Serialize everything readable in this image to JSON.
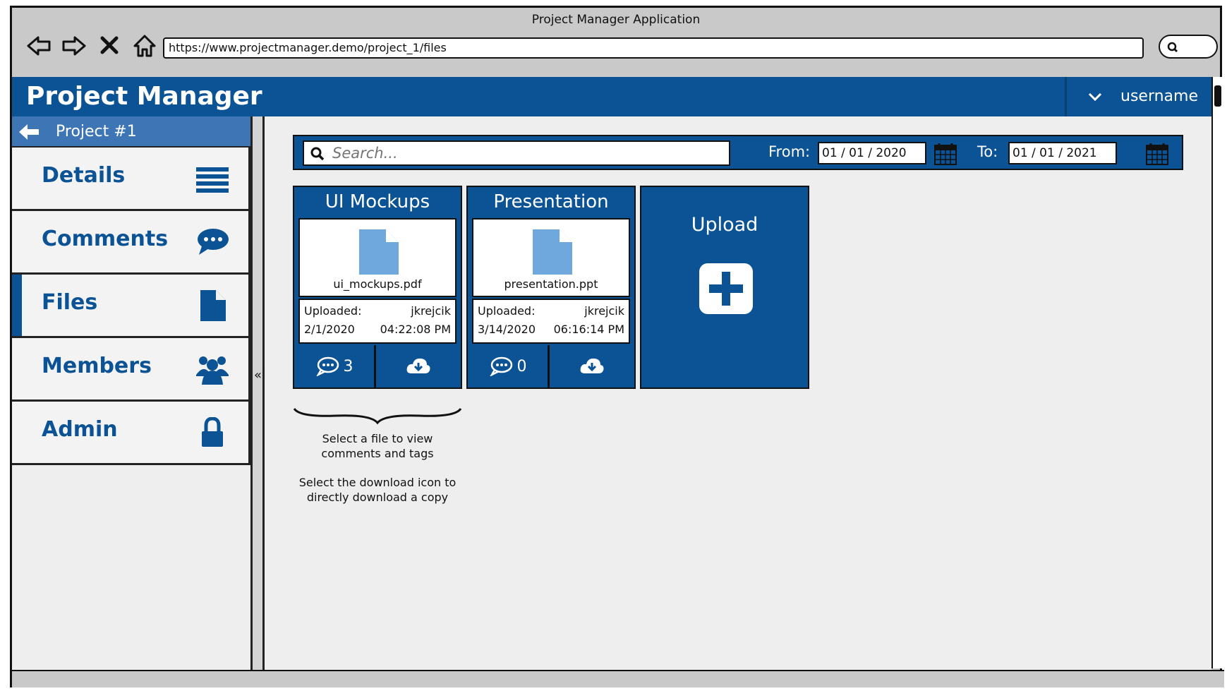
{
  "browser": {
    "window_title": "Project Manager Application",
    "url": "https://www.projectmanager.demo/project_1/files"
  },
  "header": {
    "app_title": "Project Manager",
    "username": "username"
  },
  "sidebar": {
    "project_label": "Project #1",
    "items": [
      {
        "label": "Details",
        "icon": "list-icon"
      },
      {
        "label": "Comments",
        "icon": "comments-icon"
      },
      {
        "label": "Files",
        "icon": "file-icon",
        "active": true
      },
      {
        "label": "Members",
        "icon": "users-icon"
      },
      {
        "label": "Admin",
        "icon": "lock-icon"
      }
    ],
    "collapse_glyph": "«"
  },
  "filters": {
    "search_placeholder": "Search...",
    "from_label": "From:",
    "from_value": "01 / 01 / 2020",
    "to_label": "To:",
    "to_value": "01 / 01 / 2021"
  },
  "files": [
    {
      "title": "UI Mockups",
      "filename": "ui_mockups.pdf",
      "uploaded_label": "Uploaded:",
      "uploader": "jkrejcik",
      "date": "2/1/2020",
      "time": "04:22:08 PM",
      "comment_count": "3"
    },
    {
      "title": "Presentation",
      "filename": "presentation.ppt",
      "uploaded_label": "Uploaded:",
      "uploader": "jkrejcik",
      "date": "3/14/2020",
      "time": "06:16:14 PM",
      "comment_count": "0"
    }
  ],
  "upload": {
    "label": "Upload"
  },
  "annotation": {
    "line1": "Select a file to view comments and tags",
    "line2": "Select the download icon to directly download a copy"
  },
  "colors": {
    "primary": "#0b5394",
    "project_bar": "#3d75b5",
    "file_icon": "#6fa8dc",
    "background": "#eeeeee"
  }
}
